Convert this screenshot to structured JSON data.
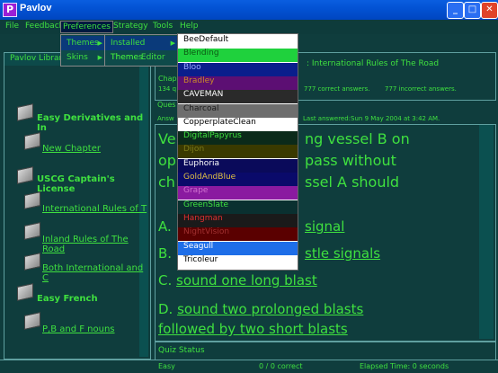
{
  "window": {
    "title": "Pavlov",
    "app_icon": "P"
  },
  "menubar": [
    "File",
    "Feedback",
    "Preferences",
    "Strategy",
    "Tools",
    "Help"
  ],
  "preferences_menu": [
    {
      "label": "Themes",
      "has_submenu": true
    },
    {
      "label": "Skins",
      "has_submenu": true
    }
  ],
  "themes_submenu": [
    {
      "label": "Installed Themes",
      "has_submenu": true
    },
    {
      "label": "Theme Editor",
      "has_submenu": false
    }
  ],
  "installed_themes": [
    {
      "label": "BeeDefault",
      "bg": "#ffffff",
      "fg": "#000000"
    },
    {
      "label": "Blending",
      "bg": "#1fd13d",
      "fg": "#0b5a14"
    },
    {
      "label": "Bloo",
      "bg": "#0a1e8c",
      "fg": "#9aa8ff"
    },
    {
      "label": "Bradley",
      "bg": "#5c0f73",
      "fg": "#c98a2a"
    },
    {
      "label": "CAVEMAN",
      "bg": "#2a2a2a",
      "fg": "#ffffff"
    },
    {
      "label": "Charcoal",
      "bg": "#6e6e6e",
      "fg": "#1c1c1c"
    },
    {
      "label": "CopperplateClean",
      "bg": "#ffffff",
      "fg": "#000000"
    },
    {
      "label": "DigitalPapyrus",
      "bg": "#0b2a1a",
      "fg": "#3fe03f"
    },
    {
      "label": "Dijon",
      "bg": "#3a3a00",
      "fg": "#7a7a1a"
    },
    {
      "label": "Euphoria",
      "bg": "#0a0a5a",
      "fg": "#ffffff"
    },
    {
      "label": "GoldAndBlue",
      "bg": "#0a0a6a",
      "fg": "#e0c040"
    },
    {
      "label": "Grape",
      "bg": "#8a1aa0",
      "fg": "#d070d0"
    },
    {
      "label": "GreenSlate",
      "bg": "#0a3030",
      "fg": "#3fe03f"
    },
    {
      "label": "Hangman",
      "bg": "#1a1a1a",
      "fg": "#e03030"
    },
    {
      "label": "NightVision",
      "bg": "#5a0000",
      "fg": "#a03030"
    },
    {
      "label": "Seagull",
      "bg": "#1e6ee8",
      "fg": "#ffffff"
    },
    {
      "label": "Tricoleur",
      "bg": "#ffffff",
      "fg": "#000000"
    }
  ],
  "library": {
    "title": "Pavlov Library",
    "groups": [
      {
        "name": "Easy Derivatives and In",
        "items": [
          "New Chapter"
        ]
      },
      {
        "name": "USCG Captain's License",
        "items": [
          "International Rules of T",
          "Inland Rules of The Road",
          "Both International and C"
        ]
      },
      {
        "name": "Easy French",
        "items": [
          "P,B and F nouns"
        ]
      }
    ]
  },
  "chapter": {
    "header": ": International Rules of The Road",
    "chap_label": "Chap",
    "correct": "777 correct answers.",
    "incorrect": "777 incorrect answers.",
    "count_prefix": "134 q",
    "ques_label": "Ques",
    "answ_label": "Answ",
    "last_answered": "Last answered:Sun 9 May 2004 at 3:42 AM."
  },
  "question": {
    "line1_prefix": "Ve",
    "line1": "ng vessel B on",
    "line2_prefix": "op",
    "line2": "pass without",
    "line3_prefix": "ch",
    "line3": "ssel A should"
  },
  "answers": [
    {
      "letter": "A.",
      "text": "signal"
    },
    {
      "letter": "B.",
      "text": "stle signals"
    },
    {
      "letter": "C.",
      "text": "sound one long blast"
    },
    {
      "letter": "D.",
      "text": "sound two prolonged blasts followed by two short blasts"
    }
  ],
  "quiz_status": {
    "title": "Quiz Status",
    "left": "Easy",
    "middle": "0 / 0 correct",
    "elapsed": "Elapsed Time: 0 seconds"
  },
  "colors": {
    "accent": "#3fe03f",
    "background": "#0f3d3d",
    "titlebar": "#0353d4"
  }
}
